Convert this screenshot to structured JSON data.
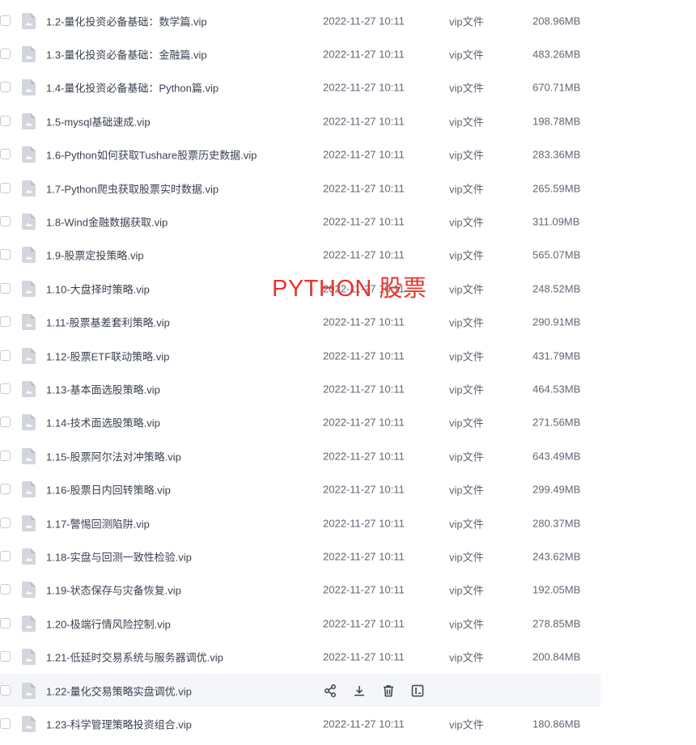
{
  "files": [
    {
      "name": "1.2-量化投资必备基础：数学篇.vip",
      "time": "2022-11-27 10:11",
      "type": "vip文件",
      "size": "208.96MB"
    },
    {
      "name": "1.3-量化投资必备基础：金融篇.vip",
      "time": "2022-11-27 10:11",
      "type": "vip文件",
      "size": "483.26MB"
    },
    {
      "name": "1.4-量化投资必备基础：Python篇.vip",
      "time": "2022-11-27 10:11",
      "type": "vip文件",
      "size": "670.71MB"
    },
    {
      "name": "1.5-mysql基础速成.vip",
      "time": "2022-11-27 10:11",
      "type": "vip文件",
      "size": "198.78MB"
    },
    {
      "name": "1.6-Python如何获取Tushare股票历史数据.vip",
      "time": "2022-11-27 10:11",
      "type": "vip文件",
      "size": "283.36MB"
    },
    {
      "name": "1.7-Python爬虫获取股票实时数据.vip",
      "time": "2022-11-27 10:11",
      "type": "vip文件",
      "size": "265.59MB"
    },
    {
      "name": "1.8-Wind金融数据获取.vip",
      "time": "2022-11-27 10:11",
      "type": "vip文件",
      "size": "311.09MB"
    },
    {
      "name": "1.9-股票定投策略.vip",
      "time": "2022-11-27 10:11",
      "type": "vip文件",
      "size": "565.07MB"
    },
    {
      "name": "1.10-大盘择时策略.vip",
      "time": "2022-11-27 10:11",
      "type": "vip文件",
      "size": "248.52MB"
    },
    {
      "name": "1.11-股票基差套利策略.vip",
      "time": "2022-11-27 10:11",
      "type": "vip文件",
      "size": "290.91MB"
    },
    {
      "name": "1.12-股票ETF联动策略.vip",
      "time": "2022-11-27 10:11",
      "type": "vip文件",
      "size": "431.79MB"
    },
    {
      "name": "1.13-基本面选股策略.vip",
      "time": "2022-11-27 10:11",
      "type": "vip文件",
      "size": "464.53MB"
    },
    {
      "name": "1.14-技术面选股策略.vip",
      "time": "2022-11-27 10:11",
      "type": "vip文件",
      "size": "271.56MB"
    },
    {
      "name": "1.15-股票阿尔法对冲策略.vip",
      "time": "2022-11-27 10:11",
      "type": "vip文件",
      "size": "643.49MB"
    },
    {
      "name": "1.16-股票日内回转策略.vip",
      "time": "2022-11-27 10:11",
      "type": "vip文件",
      "size": "299.49MB"
    },
    {
      "name": "1.17-警惕回测陷阱.vip",
      "time": "2022-11-27 10:11",
      "type": "vip文件",
      "size": "280.37MB"
    },
    {
      "name": "1.18-实盘与回测一致性检验.vip",
      "time": "2022-11-27 10:11",
      "type": "vip文件",
      "size": "243.62MB"
    },
    {
      "name": "1.19-状态保存与灾备恢复.vip",
      "time": "2022-11-27 10:11",
      "type": "vip文件",
      "size": "192.05MB"
    },
    {
      "name": "1.20-极端行情风险控制.vip",
      "time": "2022-11-27 10:11",
      "type": "vip文件",
      "size": "278.85MB"
    },
    {
      "name": "1.21-低延时交易系统与服务器调优.vip",
      "time": "2022-11-27 10:11",
      "type": "vip文件",
      "size": "200.84MB"
    },
    {
      "name": "1.22-量化交易策略实盘调优.vip",
      "time": "",
      "type": "",
      "size": "",
      "hovered": true
    },
    {
      "name": "1.23-科学管理策略投资组合.vip",
      "time": "2022-11-27 10:11",
      "type": "vip文件",
      "size": "180.86MB"
    }
  ],
  "row_actions": [
    "share-icon",
    "download-icon",
    "delete-icon",
    "rename-icon"
  ],
  "watermark": "PYTHON 股票",
  "colors": {
    "watermark": "#e8352b",
    "icon": "#c9ccd3",
    "hover_row": "#f5f6f9"
  }
}
